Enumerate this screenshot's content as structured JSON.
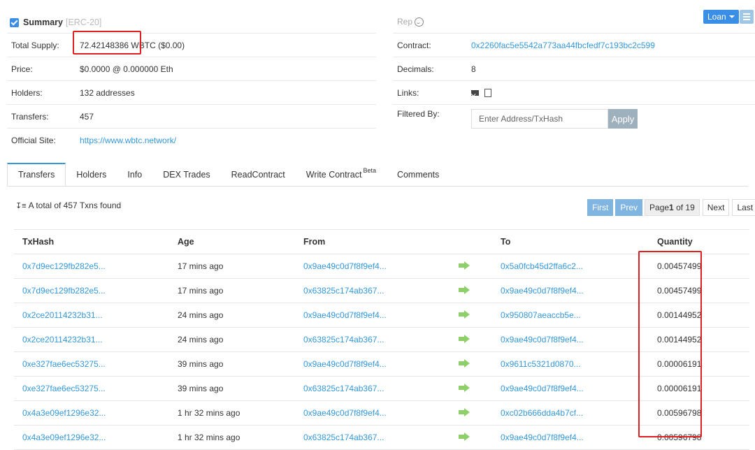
{
  "summary": {
    "title": "Summary",
    "standard": "[ERC-20]",
    "rows": [
      {
        "label": "Total Supply:",
        "value": "72.42148386 WBTC ($0.00)"
      },
      {
        "label": "Price:",
        "value": "$0.0000 @ 0.000000 Eth"
      },
      {
        "label": "Holders:",
        "value": "132 addresses"
      },
      {
        "label": "Transfers:",
        "value": "457"
      },
      {
        "label": "Official Site:",
        "value": "https://www.wbtc.network/"
      }
    ]
  },
  "right": {
    "rep": "Rep",
    "contract_label": "Contract:",
    "contract_value": "0x2260fac5e5542a773aa44fbcfedf7c193bc2c599",
    "decimals_label": "Decimals:",
    "decimals_value": "8",
    "links_label": "Links:",
    "filtered_label": "Filtered By:",
    "filter_placeholder": "Enter Address/TxHash",
    "apply": "Apply",
    "loan": "Loan"
  },
  "tabs": [
    "Transfers",
    "Holders",
    "Info",
    "DEX Trades",
    "ReadContract",
    "Write Contract",
    "Comments"
  ],
  "tab_beta": "Beta",
  "txcount": "A total of 457 Txns found",
  "pager": {
    "first": "First",
    "prev": "Prev",
    "page_prefix": "Page ",
    "page_num": "1",
    "page_suffix": " of 19",
    "next": "Next",
    "last": "Last"
  },
  "table": {
    "headers": [
      "TxHash",
      "Age",
      "From",
      "",
      "To",
      "Quantity"
    ],
    "rows": [
      [
        "0x7d9ec129fb282e5...",
        "17 mins ago",
        "0x9ae49c0d7f8f9ef4...",
        "0x5a0fcb45d2ffa6c2...",
        "0.00457499"
      ],
      [
        "0x7d9ec129fb282e5...",
        "17 mins ago",
        "0x63825c174ab367...",
        "0x9ae49c0d7f8f9ef4...",
        "0.00457499"
      ],
      [
        "0x2ce20114232b31...",
        "24 mins ago",
        "0x9ae49c0d7f8f9ef4...",
        "0x950807aeaccb5e...",
        "0.00144952"
      ],
      [
        "0x2ce20114232b31...",
        "24 mins ago",
        "0x63825c174ab367...",
        "0x9ae49c0d7f8f9ef4...",
        "0.00144952"
      ],
      [
        "0xe327fae6ec53275...",
        "39 mins ago",
        "0x9ae49c0d7f8f9ef4...",
        "0x9611c5321d0870...",
        "0.00006191"
      ],
      [
        "0xe327fae6ec53275...",
        "39 mins ago",
        "0x63825c174ab367...",
        "0x9ae49c0d7f8f9ef4...",
        "0.00006191"
      ],
      [
        "0x4a3e09ef1296e32...",
        "1 hr 32 mins ago",
        "0x9ae49c0d7f8f9ef4...",
        "0xc02b666dda4b7cf...",
        "0.00596798"
      ],
      [
        "0x4a3e09ef1296e32...",
        "1 hr 32 mins ago",
        "0x63825c174ab367...",
        "0x9ae49c0d7f8f9ef4...",
        "0.00596798"
      ]
    ]
  },
  "colors": {
    "link": "#3498db",
    "highlight": "#e02020",
    "arrow": "#8fcf6a"
  }
}
